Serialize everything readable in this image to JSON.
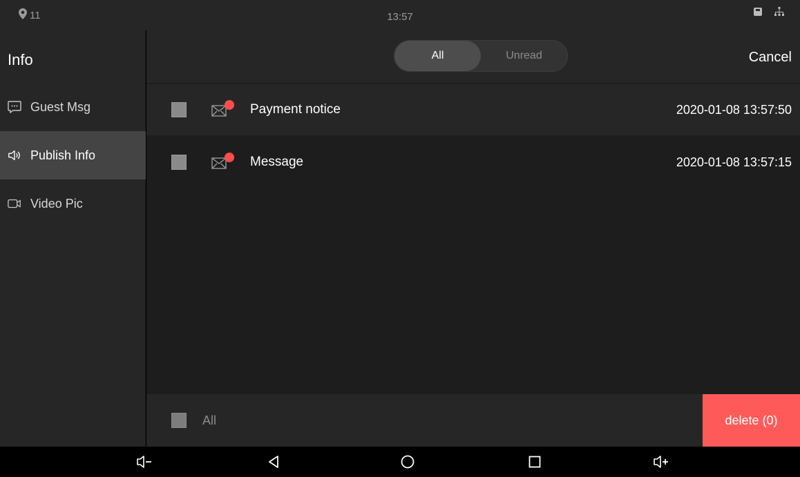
{
  "status_bar": {
    "notification_count": "11",
    "time": "13:57"
  },
  "sidebar": {
    "title": "Info",
    "items": [
      {
        "label": "Guest Msg",
        "icon": "chat-bubble-icon",
        "active": false
      },
      {
        "label": "Publish Info",
        "icon": "speaker-icon",
        "active": true
      },
      {
        "label": "Video Pic",
        "icon": "video-camera-icon",
        "active": false
      }
    ]
  },
  "header": {
    "filter_all": "All",
    "filter_unread": "Unread",
    "selected_filter": "All",
    "cancel_label": "Cancel"
  },
  "messages": [
    {
      "title": "Payment notice",
      "time": "2020-01-08 13:57:50",
      "unread": true,
      "checked": false
    },
    {
      "title": "Message",
      "time": "2020-01-08 13:57:15",
      "unread": true,
      "checked": false
    }
  ],
  "footer": {
    "select_all_label": "All",
    "delete_label": "delete (0)"
  },
  "colors": {
    "accent_delete": "#ff5a5a",
    "unread_dot": "#ff4d4d",
    "panel": "#262626",
    "background": "#1d1d1d"
  }
}
